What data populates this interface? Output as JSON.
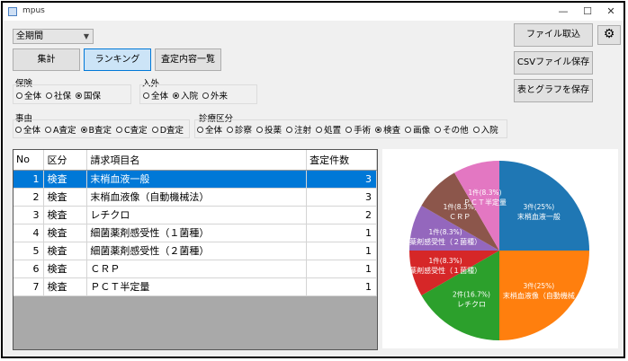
{
  "window": {
    "title": "mpus",
    "minimize": "—",
    "maximize": "☐",
    "close": "✕"
  },
  "period": {
    "selected": "全期間"
  },
  "buttons": {
    "aggregate": "集計",
    "ranking": "ランキング",
    "list": "査定内容一覧",
    "import": "ファイル取込",
    "csv_save": "CSVファイル保存",
    "save_table_graph": "表とグラフを保存"
  },
  "insurance": {
    "label": "保険",
    "options": [
      "全体",
      "社保",
      "国保"
    ],
    "selected": 2
  },
  "inout": {
    "label": "入外",
    "options": [
      "全体",
      "入院",
      "外来"
    ],
    "selected": 1
  },
  "reason": {
    "label": "事由",
    "options": [
      "全体",
      "A査定",
      "B査定",
      "C査定",
      "D査定"
    ],
    "selected": 2
  },
  "category": {
    "label": "診療区分",
    "options": [
      "全体",
      "診察",
      "投薬",
      "注射",
      "処置",
      "手術",
      "検査",
      "画像",
      "その他",
      "入院"
    ],
    "selected": 6
  },
  "table": {
    "headers": [
      "No",
      "区分",
      "請求項目名",
      "査定件数"
    ],
    "rows": [
      {
        "no": "1",
        "kubun": "検査",
        "name": "末梢血液一般",
        "count": "3"
      },
      {
        "no": "2",
        "kubun": "検査",
        "name": "末梢血液像（自動機械法）",
        "count": "3"
      },
      {
        "no": "3",
        "kubun": "検査",
        "name": "レチクロ",
        "count": "2"
      },
      {
        "no": "4",
        "kubun": "検査",
        "name": "細菌薬剤感受性（１菌種）",
        "count": "1"
      },
      {
        "no": "5",
        "kubun": "検査",
        "name": "細菌薬剤感受性（２菌種）",
        "count": "1"
      },
      {
        "no": "6",
        "kubun": "検査",
        "name": "ＣＲＰ",
        "count": "1"
      },
      {
        "no": "7",
        "kubun": "検査",
        "name": "ＰＣＴ半定量",
        "count": "1"
      }
    ],
    "selected_row": 0
  },
  "chart_data": {
    "type": "pie",
    "categories": [
      "末梢血液一般",
      "末梢血液像（自動機械",
      "レチクロ",
      "薬剤感受性（１菌種）",
      "薬剤感受性（２菌種）",
      "ＣＲＰ",
      "ＰＣＴ半定量"
    ],
    "values": [
      3,
      3,
      2,
      1,
      1,
      1,
      1
    ],
    "value_labels": [
      "3件(25%)",
      "3件(25%)",
      "2件(16.7%)",
      "1件(8.3%)",
      "1件(8.3%)",
      "1件(8.3%)",
      "1件(8.3%)"
    ],
    "colors": [
      "#1f77b4",
      "#ff7f0e",
      "#2ca02c",
      "#d62728",
      "#9467bd",
      "#8c564b",
      "#e377c2"
    ]
  }
}
